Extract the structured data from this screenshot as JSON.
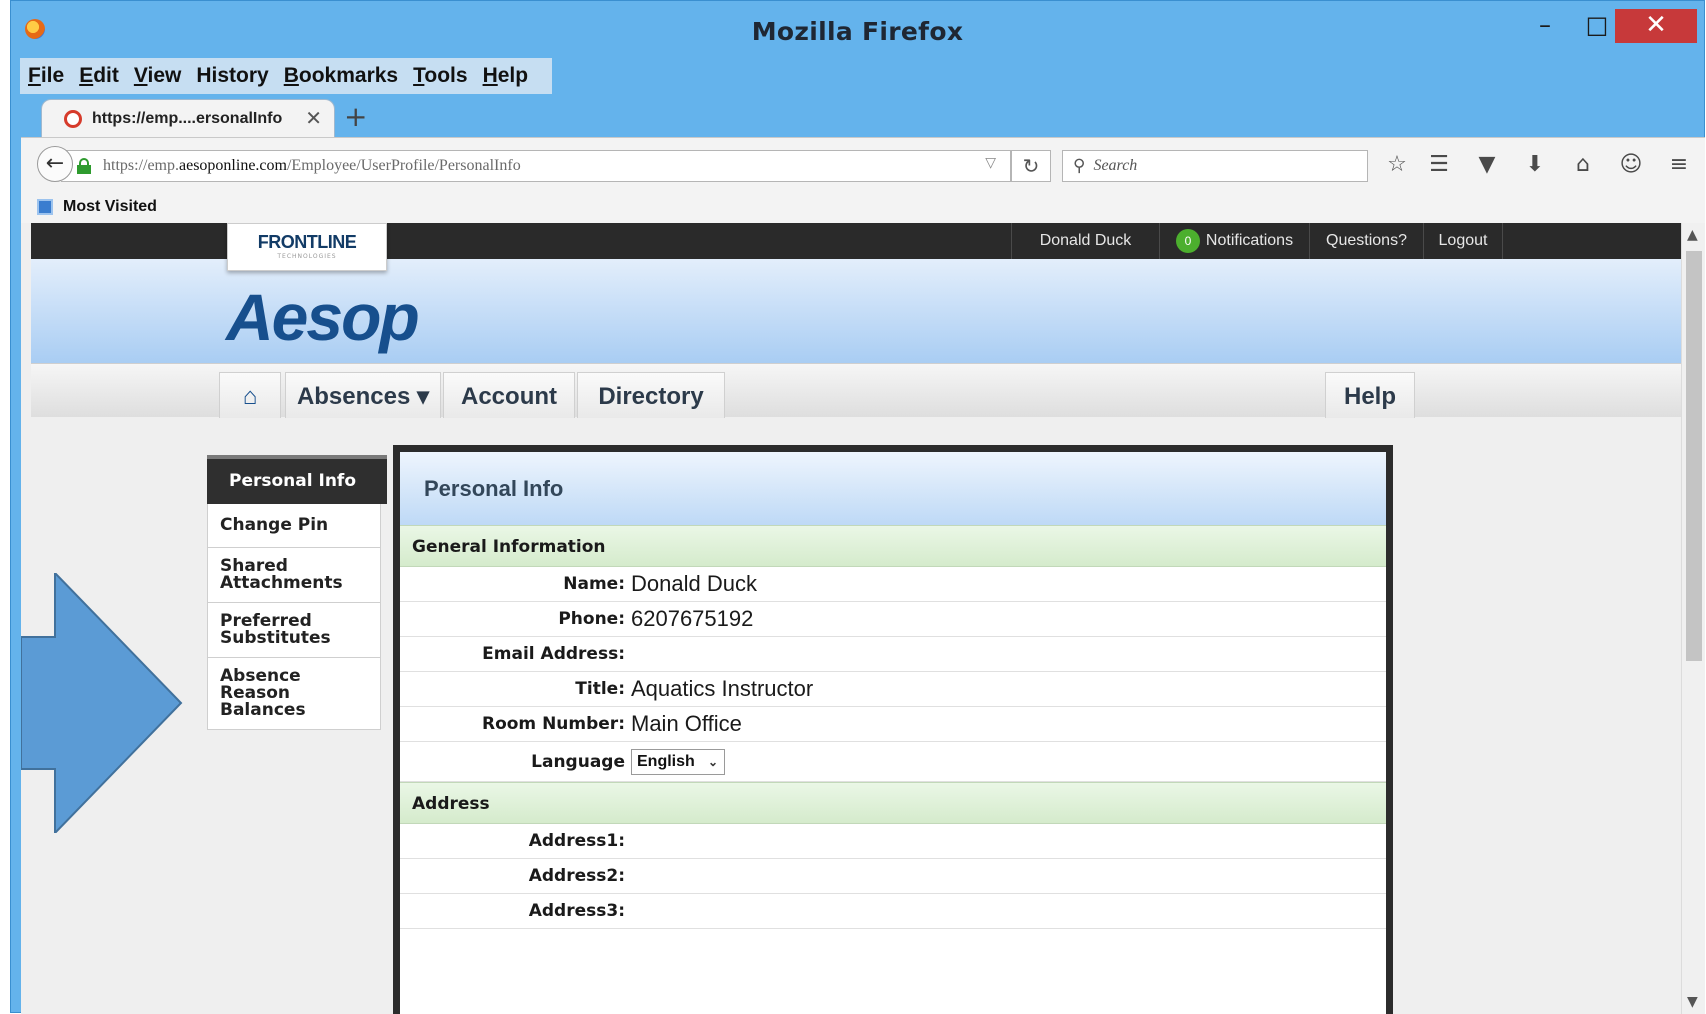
{
  "window": {
    "title": "Mozilla Firefox",
    "min_glyph": "–",
    "max_glyph": "□",
    "close_glyph": "✕"
  },
  "menubar": {
    "items": [
      {
        "label": "File",
        "key": "F",
        "rest": "ile"
      },
      {
        "label": "Edit",
        "key": "E",
        "rest": "dit"
      },
      {
        "label": "View",
        "key": "V",
        "rest": "iew"
      },
      {
        "label": "History",
        "key": "",
        "rest": "History"
      },
      {
        "label": "Bookmarks",
        "key": "B",
        "rest": "ookmarks"
      },
      {
        "label": "Tools",
        "key": "T",
        "rest": "ools"
      },
      {
        "label": "Help",
        "key": "H",
        "rest": "elp"
      }
    ]
  },
  "tab": {
    "label": "https://emp....ersonalInfo",
    "close_glyph": "✕",
    "new_tab_glyph": "+"
  },
  "navbar": {
    "back_glyph": "←",
    "url_prefix": "https://emp.",
    "url_host": "aesoponline.com",
    "url_path": "/Employee/UserProfile/PersonalInfo",
    "url_drop_glyph": "▽",
    "reload_glyph": "↻",
    "search_placeholder": "Search",
    "search_glyph": "⚲",
    "icons": {
      "bookmark": "☆",
      "reading_list": "☰",
      "pocket": "▼",
      "download": "⬇",
      "home": "⌂",
      "chat": "☺",
      "menu": "≡"
    }
  },
  "bookmarks_bar": {
    "label": "Most Visited"
  },
  "site": {
    "topbar": {
      "user": "Donald Duck",
      "notifications_count": "0",
      "notifications_label": "Notifications",
      "questions": "Questions?",
      "logout": "Logout"
    },
    "frontline": {
      "name": "FRONTLINE",
      "sub": "TECHNOLOGIES"
    },
    "logo": "Aesop",
    "nav": {
      "home_glyph": "⌂",
      "absences": "Absences ▾",
      "account": "Account",
      "directory": "Directory",
      "help": "Help"
    },
    "sidebar": {
      "items": [
        {
          "line1": "Personal Info",
          "line2": ""
        },
        {
          "line1": "Change Pin",
          "line2": ""
        },
        {
          "line1": "Shared",
          "line2": "Attachments"
        },
        {
          "line1": "Preferred",
          "line2": "Substitutes"
        },
        {
          "line1": "Absence Reason",
          "line2": "Balances"
        }
      ]
    },
    "panel": {
      "title": "Personal Info",
      "general_header": "General Information",
      "fields": {
        "name_label": "Name:",
        "name_value": "Donald Duck",
        "phone_label": "Phone:",
        "phone_value": "6207675192",
        "email_label": "Email Address:",
        "email_value": "",
        "title_label": "Title:",
        "title_value": "Aquatics Instructor",
        "room_label": "Room Number:",
        "room_value": "Main Office",
        "language_label": "Language",
        "language_value": "English"
      },
      "address_header": "Address",
      "address": {
        "address1_label": "Address1:",
        "address2_label": "Address2:",
        "address3_label": "Address3:"
      }
    },
    "arrow_color": "#5b9bd5"
  }
}
